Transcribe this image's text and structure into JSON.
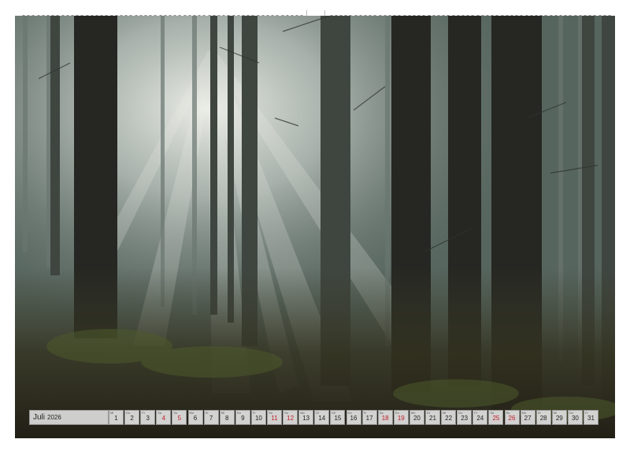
{
  "calendar": {
    "month": "Juli",
    "year": "2026",
    "days": [
      {
        "num": "1",
        "wd": "Mi",
        "weekend": false
      },
      {
        "num": "2",
        "wd": "Do",
        "weekend": false
      },
      {
        "num": "3",
        "wd": "Fr",
        "weekend": false
      },
      {
        "num": "4",
        "wd": "Sa",
        "weekend": true
      },
      {
        "num": "5",
        "wd": "So",
        "weekend": true
      },
      {
        "num": "6",
        "wd": "Mo",
        "weekend": false
      },
      {
        "num": "7",
        "wd": "Di",
        "weekend": false
      },
      {
        "num": "8",
        "wd": "Mi",
        "weekend": false
      },
      {
        "num": "9",
        "wd": "Do",
        "weekend": false
      },
      {
        "num": "10",
        "wd": "Fr",
        "weekend": false
      },
      {
        "num": "11",
        "wd": "Sa",
        "weekend": true
      },
      {
        "num": "12",
        "wd": "So",
        "weekend": true
      },
      {
        "num": "13",
        "wd": "Mo",
        "weekend": false
      },
      {
        "num": "14",
        "wd": "Di",
        "weekend": false
      },
      {
        "num": "15",
        "wd": "Mi",
        "weekend": false
      },
      {
        "num": "16",
        "wd": "Do",
        "weekend": false
      },
      {
        "num": "17",
        "wd": "Fr",
        "weekend": false
      },
      {
        "num": "18",
        "wd": "Sa",
        "weekend": true
      },
      {
        "num": "19",
        "wd": "So",
        "weekend": true
      },
      {
        "num": "20",
        "wd": "Mo",
        "weekend": false
      },
      {
        "num": "21",
        "wd": "Di",
        "weekend": false
      },
      {
        "num": "22",
        "wd": "Mi",
        "weekend": false
      },
      {
        "num": "23",
        "wd": "Do",
        "weekend": false
      },
      {
        "num": "24",
        "wd": "Fr",
        "weekend": false
      },
      {
        "num": "25",
        "wd": "Sa",
        "weekend": true
      },
      {
        "num": "26",
        "wd": "So",
        "weekend": true
      },
      {
        "num": "27",
        "wd": "Mo",
        "weekend": false
      },
      {
        "num": "28",
        "wd": "Di",
        "weekend": false
      },
      {
        "num": "29",
        "wd": "Mi",
        "weekend": false
      },
      {
        "num": "30",
        "wd": "Do",
        "weekend": false
      },
      {
        "num": "31",
        "wd": "Fr",
        "weekend": false
      }
    ]
  },
  "photo": {
    "subject": "forest-sunbeams",
    "colors": {
      "trunk": "#2b2c26",
      "haze": "#cfd6d0",
      "ground": "#3a3526",
      "moss": "#4d5a2c"
    }
  }
}
